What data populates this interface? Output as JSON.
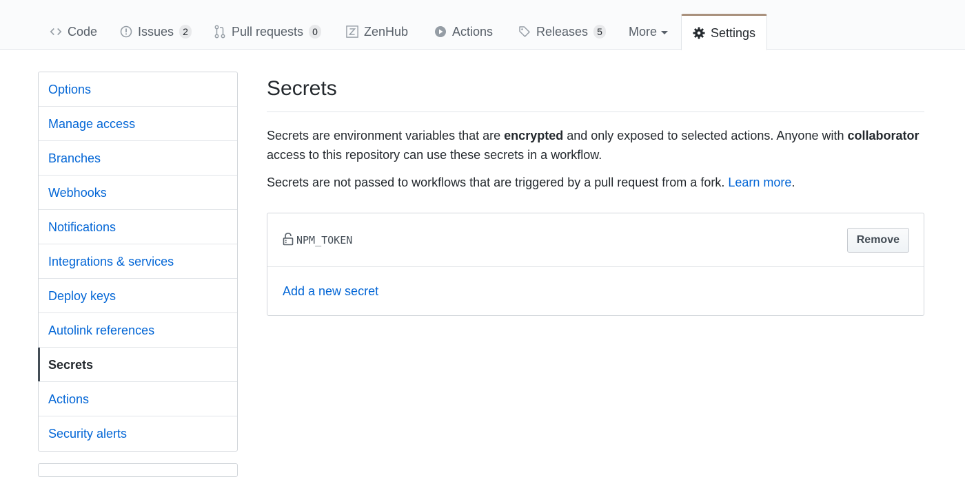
{
  "nav": {
    "tabs": [
      {
        "label": "Code",
        "icon": "code-icon"
      },
      {
        "label": "Issues",
        "icon": "issue-icon",
        "count": "2"
      },
      {
        "label": "Pull requests",
        "icon": "git-pull-request-icon",
        "count": "0"
      },
      {
        "label": "ZenHub",
        "icon": "zenhub-icon"
      },
      {
        "label": "Actions",
        "icon": "play-icon"
      },
      {
        "label": "Releases",
        "icon": "tag-icon",
        "count": "5"
      },
      {
        "label": "More",
        "icon": "caret-down-icon"
      },
      {
        "label": "Settings",
        "icon": "gear-icon",
        "selected": true
      }
    ]
  },
  "sidebar": {
    "items": [
      {
        "label": "Options"
      },
      {
        "label": "Manage access"
      },
      {
        "label": "Branches"
      },
      {
        "label": "Webhooks"
      },
      {
        "label": "Notifications"
      },
      {
        "label": "Integrations & services"
      },
      {
        "label": "Deploy keys"
      },
      {
        "label": "Autolink references"
      },
      {
        "label": "Secrets",
        "selected": true
      },
      {
        "label": "Actions"
      },
      {
        "label": "Security alerts"
      }
    ]
  },
  "main": {
    "title": "Secrets",
    "intro": {
      "p1_a": "Secrets are environment variables that are ",
      "p1_b": "encrypted",
      "p1_c": " and only exposed to selected actions. Anyone with ",
      "p1_d": "collaborator",
      "p1_e": " access to this repository can use these secrets in a workflow.",
      "p2_a": "Secrets are not passed to workflows that are triggered by a pull request from a fork. ",
      "p2_link": "Learn more",
      "p2_end": "."
    },
    "secrets": [
      {
        "name": "NPM_TOKEN",
        "icon": "lock-icon",
        "action_label": "Remove"
      }
    ],
    "add_secret_label": "Add a new secret"
  },
  "colors": {
    "link": "#0366d6",
    "settings_tab_accent": "#a9917d",
    "text": "#24292e",
    "muted": "#586069"
  }
}
